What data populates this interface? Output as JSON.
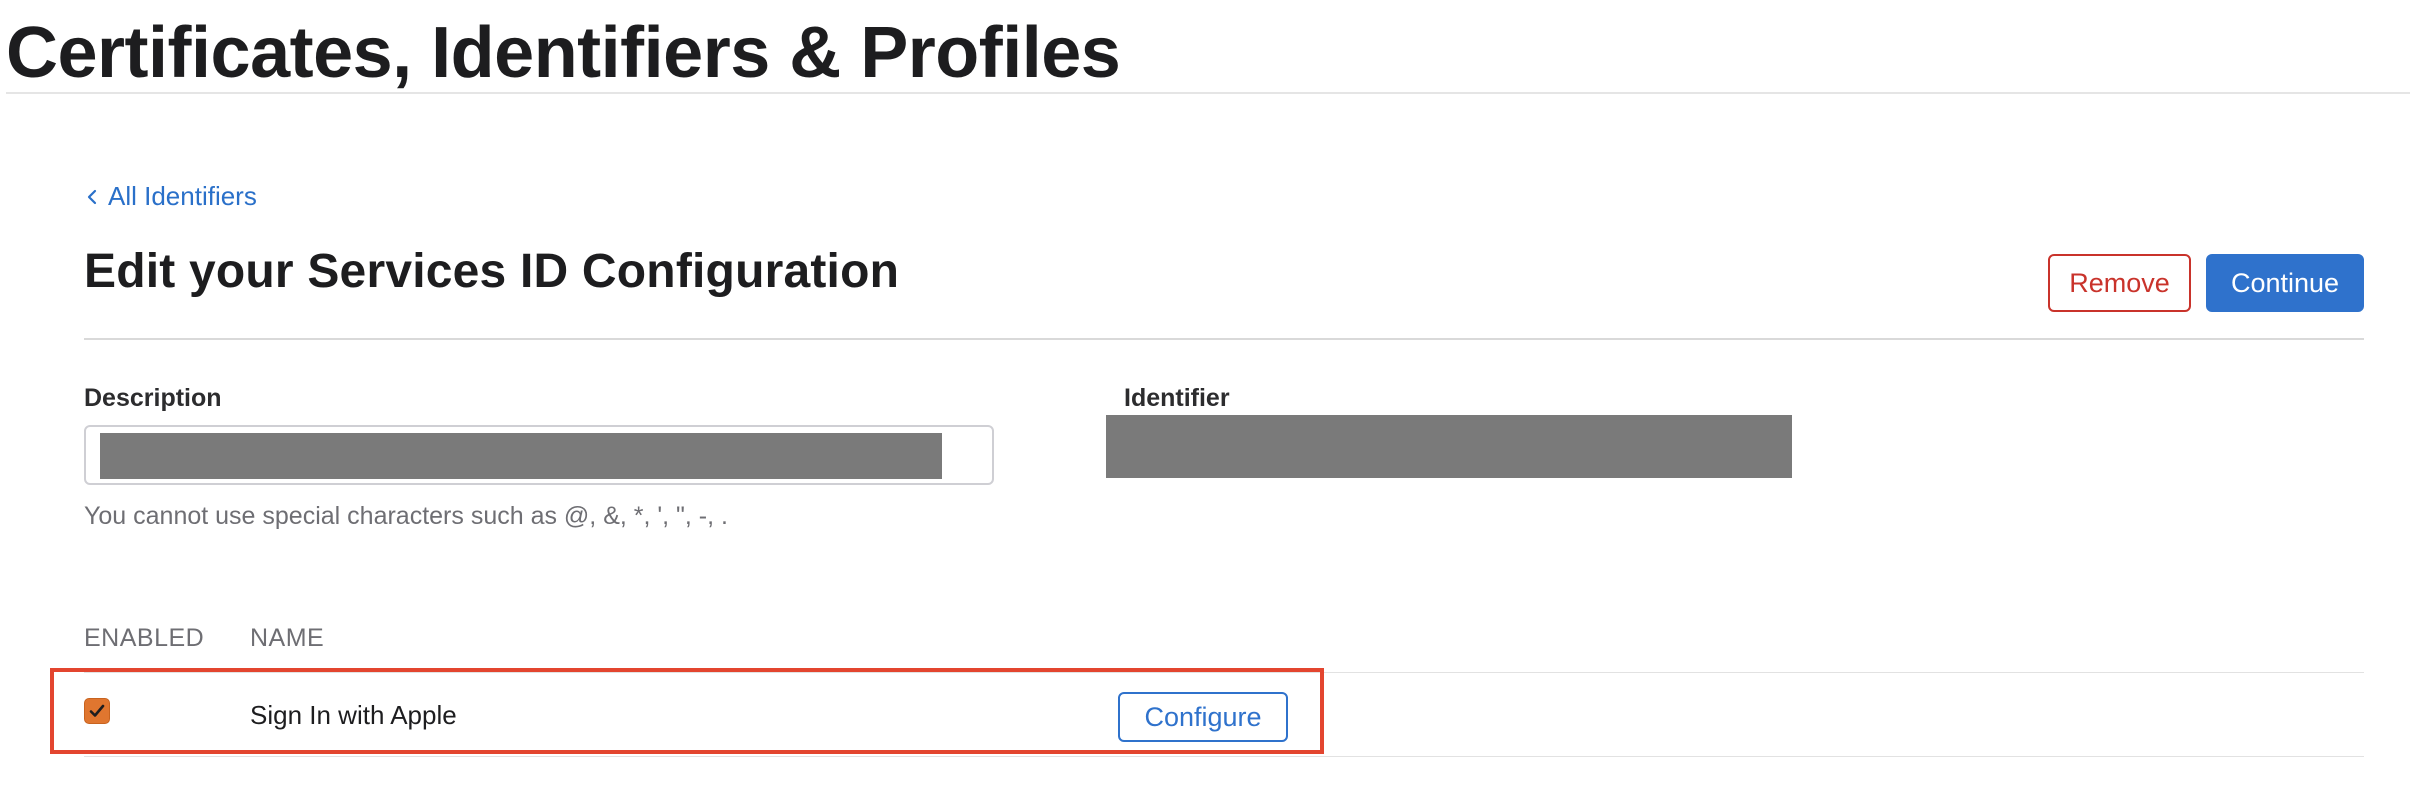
{
  "page": {
    "title": "Certificates, Identifiers & Profiles"
  },
  "nav": {
    "back_label": "All Identifiers"
  },
  "section": {
    "title": "Edit your Services ID Configuration",
    "remove_label": "Remove",
    "continue_label": "Continue"
  },
  "form": {
    "description_label": "Description",
    "identifier_label": "Identifier",
    "hint": "You cannot use special characters such as @, &, *, ', \", -, ."
  },
  "capabilities": {
    "columns": [
      "ENABLED",
      "NAME"
    ],
    "rows": [
      {
        "enabled": true,
        "name": "Sign In with Apple",
        "action_label": "Configure"
      }
    ]
  },
  "colors": {
    "link": "#2a70c9",
    "primary": "#2f72cc",
    "danger": "#c9332b",
    "checkbox": "#e0762f",
    "highlight": "#e3452f",
    "redaction": "#7a7a7a"
  }
}
